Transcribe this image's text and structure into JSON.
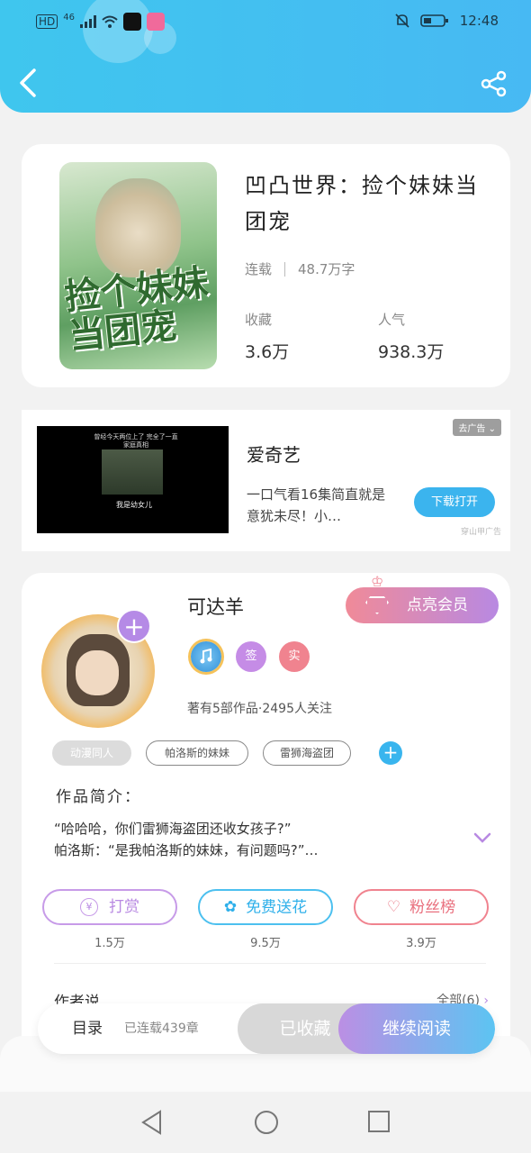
{
  "status": {
    "network": "HD",
    "signal": "46",
    "time": "12:48"
  },
  "book": {
    "title": "凹凸世界：捡个妹妹当团宠",
    "cover_text": "捡个妹妹当团宠",
    "state": "连载",
    "words": "48.7万字",
    "fav_label": "收藏",
    "fav_value": "3.6万",
    "pop_label": "人气",
    "pop_value": "938.3万"
  },
  "ad": {
    "video_caption": "曾经今天两位上了 完全了一直 家庭真相",
    "video_caption2": "我是幼女儿",
    "name": "爱奇艺",
    "desc": "一口气看16集简直就是意犹未尽！小…",
    "tag": "去广告",
    "button": "下载打开",
    "source": "穿山甲广告"
  },
  "author": {
    "name": "可达羊",
    "vip_label": "点亮会员",
    "badges": [
      "签",
      "实"
    ],
    "stats": "著有5部作品·2495人关注",
    "tags": [
      "动漫同人",
      "帕洛斯的妹妹",
      "雷狮海盗团"
    ],
    "intro_header": "作品简介：",
    "intro_line1": "“哈哈哈，你们雷狮海盗团还收女孩子?”",
    "intro_line2": "帕洛斯：“是我帕洛斯的妹妹，有问题吗?”…",
    "actions": [
      {
        "label": "打赏",
        "count": "1.5万"
      },
      {
        "label": "免费送花",
        "count": "9.5万"
      },
      {
        "label": "粉丝榜",
        "count": "3.9万"
      }
    ],
    "say_header": "作者说",
    "say_all": "全部(6)"
  },
  "bottom": {
    "toc": "目录",
    "chapters": "已连载439章",
    "fav": "已收藏",
    "read": "继续阅读"
  },
  "colors": {
    "accent_blue": "#3bb4ee",
    "accent_purple": "#b889e2",
    "accent_pink": "#f08a98"
  }
}
